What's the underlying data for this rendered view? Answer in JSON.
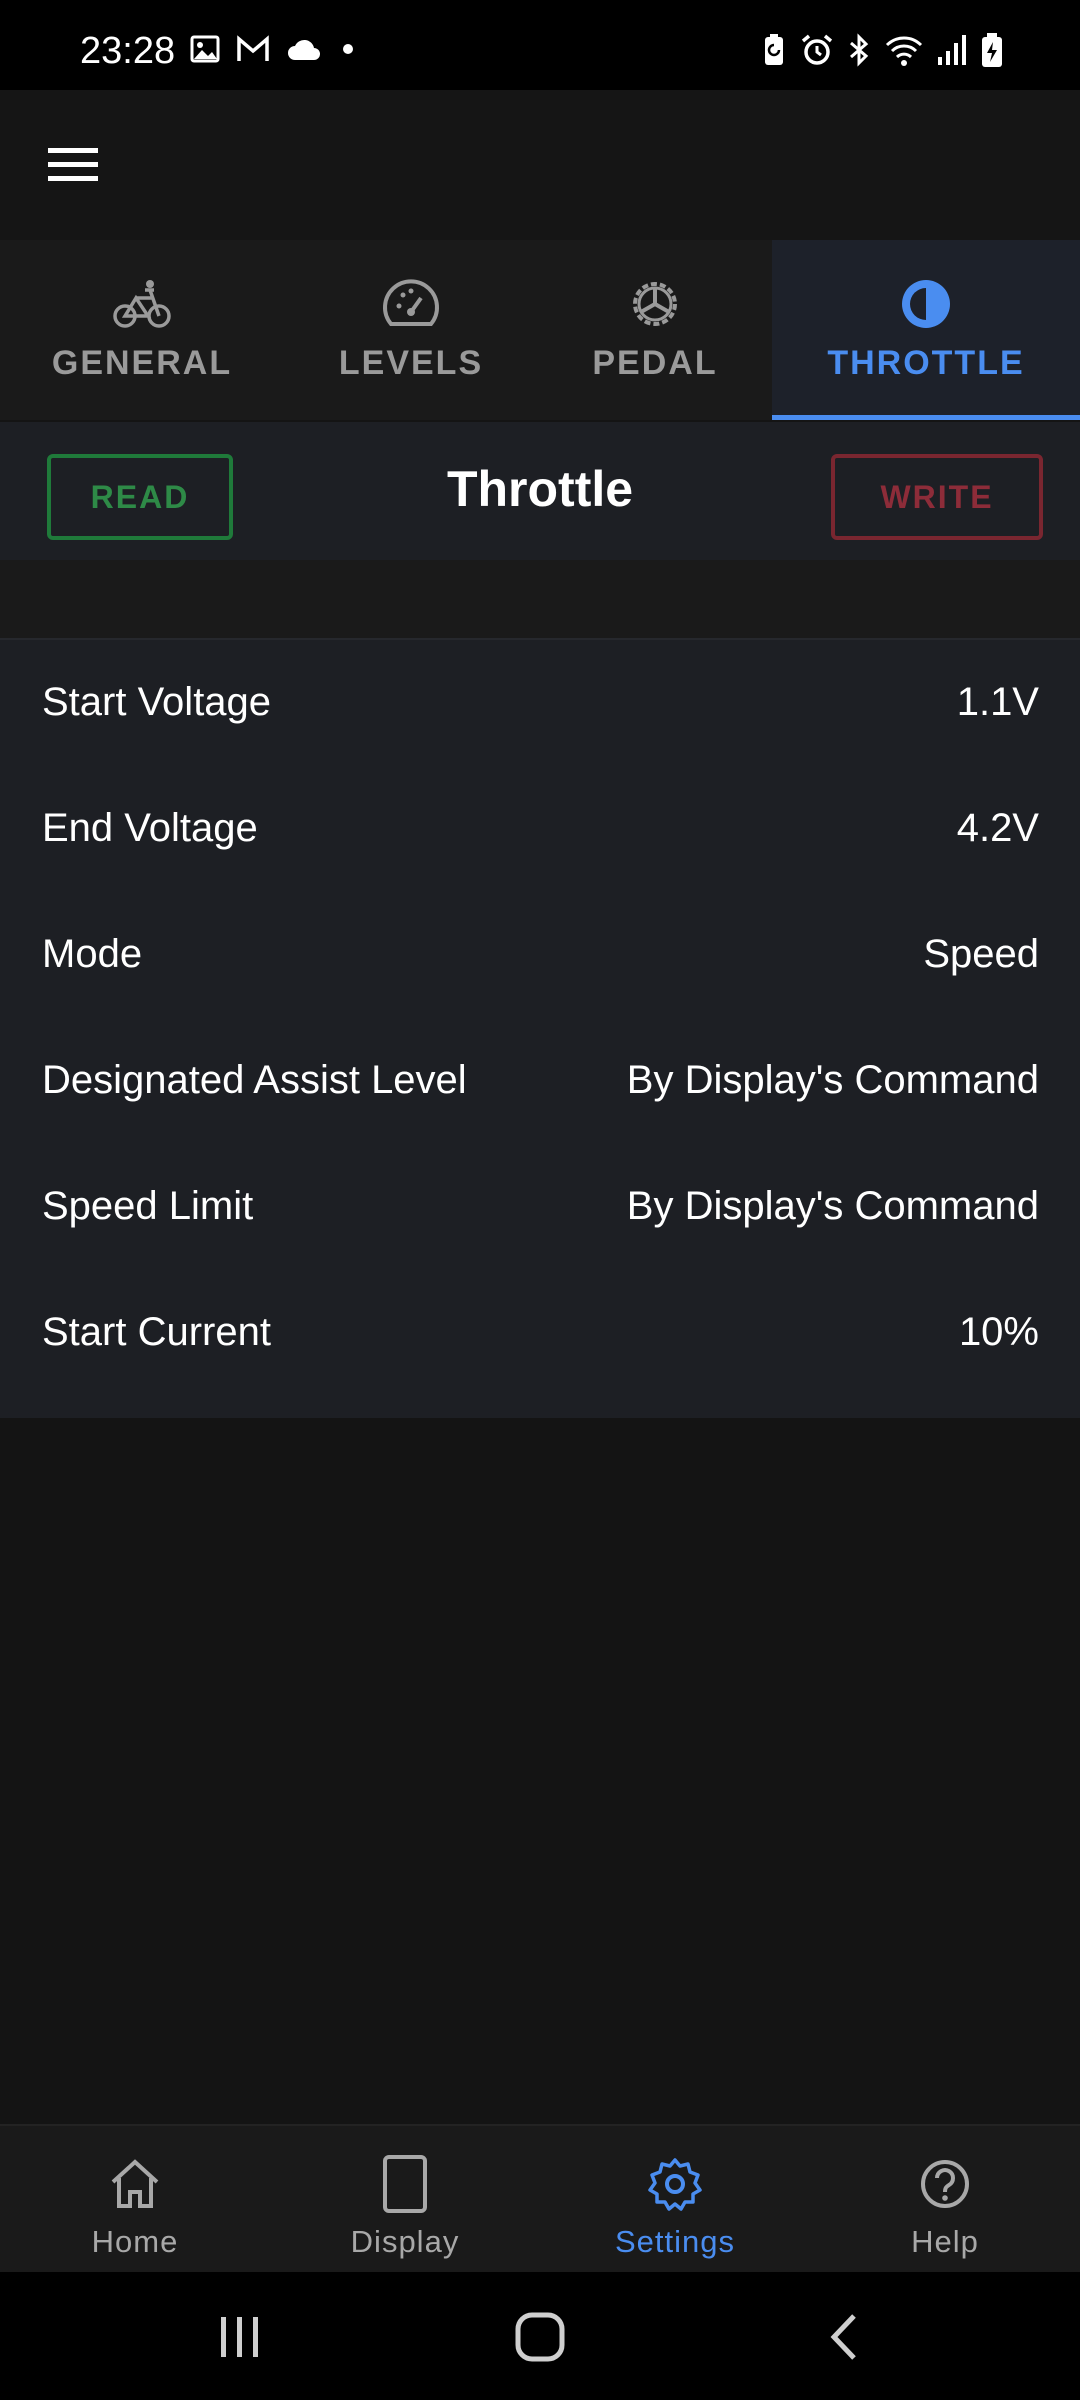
{
  "status_bar": {
    "time": "23:28"
  },
  "tabs": [
    {
      "label": "GENERAL",
      "icon": "bicycle-icon",
      "active": false
    },
    {
      "label": "LEVELS",
      "icon": "speedometer-icon",
      "active": false
    },
    {
      "label": "PEDAL",
      "icon": "chainring-icon",
      "active": false
    },
    {
      "label": "THROTTLE",
      "icon": "half-circle-icon",
      "active": true
    }
  ],
  "header": {
    "read_label": "READ",
    "title": "Throttle",
    "write_label": "WRITE"
  },
  "settings": [
    {
      "label": "Start Voltage",
      "value": "1.1V"
    },
    {
      "label": "End Voltage",
      "value": "4.2V"
    },
    {
      "label": "Mode",
      "value": "Speed"
    },
    {
      "label": "Designated Assist Level",
      "value": "By Display's Command"
    },
    {
      "label": "Speed Limit",
      "value": "By Display's Command"
    },
    {
      "label": "Start Current",
      "value": "10%"
    }
  ],
  "bottom_nav": [
    {
      "label": "Home",
      "icon": "home-icon",
      "active": false
    },
    {
      "label": "Display",
      "icon": "display-icon",
      "active": false
    },
    {
      "label": "Settings",
      "icon": "gear-icon",
      "active": true
    },
    {
      "label": "Help",
      "icon": "help-icon",
      "active": false
    }
  ],
  "colors": {
    "accent": "#4a8df0",
    "read": "#2e8a47",
    "write": "#8d2c39",
    "background": "#141414",
    "surface": "#1d1f24"
  }
}
